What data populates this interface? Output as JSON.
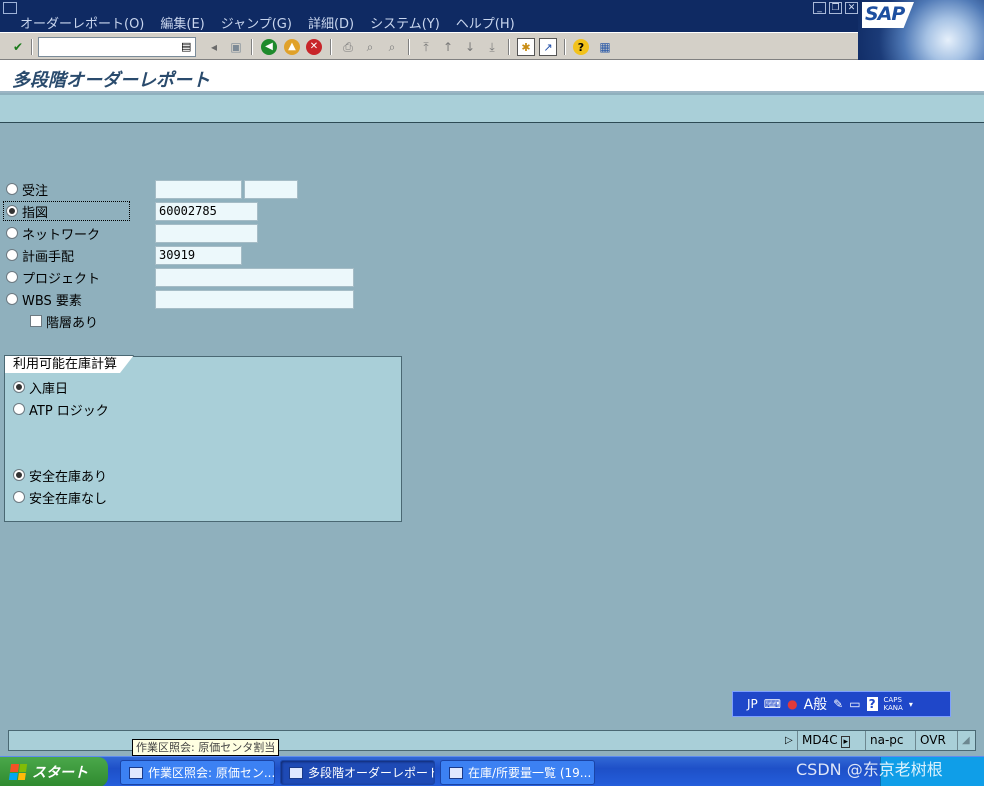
{
  "menu": {
    "items": [
      "オーダーレポート(O)",
      "編集(E)",
      "ジャンプ(G)",
      "詳細(D)",
      "システム(Y)",
      "ヘルプ(H)"
    ]
  },
  "logo": {
    "text": "SAP"
  },
  "toolbar": {
    "command_value": ""
  },
  "title": "多段階オーダーレポート",
  "selection": {
    "rows": [
      {
        "label": "受注",
        "selected": false
      },
      {
        "label": "指図",
        "selected": true,
        "value": "60002785"
      },
      {
        "label": "ネットワーク",
        "selected": false
      },
      {
        "label": "計画手配",
        "selected": false,
        "value": "30919"
      },
      {
        "label": "プロジェクト",
        "selected": false
      },
      {
        "label": "WBS 要素",
        "selected": false
      }
    ],
    "checkbox_label": "階層あり",
    "checkbox_checked": false
  },
  "group": {
    "title": "利用可能在庫計算",
    "options_a": [
      {
        "label": "入庫日",
        "selected": true
      },
      {
        "label": "ATP ロジック",
        "selected": false
      }
    ],
    "options_b": [
      {
        "label": "安全在庫あり",
        "selected": true
      },
      {
        "label": "安全在庫なし",
        "selected": false
      }
    ]
  },
  "ime": {
    "lang": "JP",
    "mode": "A般",
    "caps": "CAPS",
    "kana": "KANA"
  },
  "status": {
    "tcode": "MD4C",
    "server": "na-pc",
    "mode": "OVR"
  },
  "tooltip": "作業区照会: 原価センタ割当",
  "taskbar": {
    "start": "スタート",
    "tasks": [
      "作業区照会: 原価セン...",
      "多段階オーダーレポート",
      "在庫/所要量一覧 (19..."
    ]
  },
  "watermark": "CSDN @东京老树根"
}
